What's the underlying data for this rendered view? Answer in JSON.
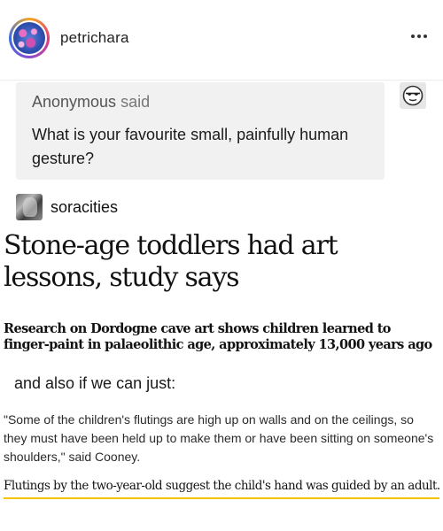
{
  "post": {
    "username": "petrichara",
    "more_icon": "more-horizontal-icon"
  },
  "ask": {
    "asker": "Anonymous",
    "said": "said",
    "question": "What is your favourite small, painfully human gesture?",
    "avatar_icon": "anonymous-sunglasses-icon"
  },
  "reblog": {
    "username": "soracities"
  },
  "article": {
    "headline": "Stone-age toddlers had art lessons, study says",
    "standfirst": "Research on Dordogne cave art shows children learned to finger-paint in palaeolithic age, approximately 13,000 years ago",
    "comment": "and also if we can just:",
    "quote": "\"Some of the children's flutings are high up on walls and on the ceilings, so they must have been held up to make them or have been sitting on someone's shoulders,\" said Cooney.",
    "caption": "Flutings by the two-year-old suggest the child's hand was guided by an adult."
  },
  "colors": {
    "highlight_underline": "#f3c300",
    "ask_background": "#f1f1f1"
  }
}
